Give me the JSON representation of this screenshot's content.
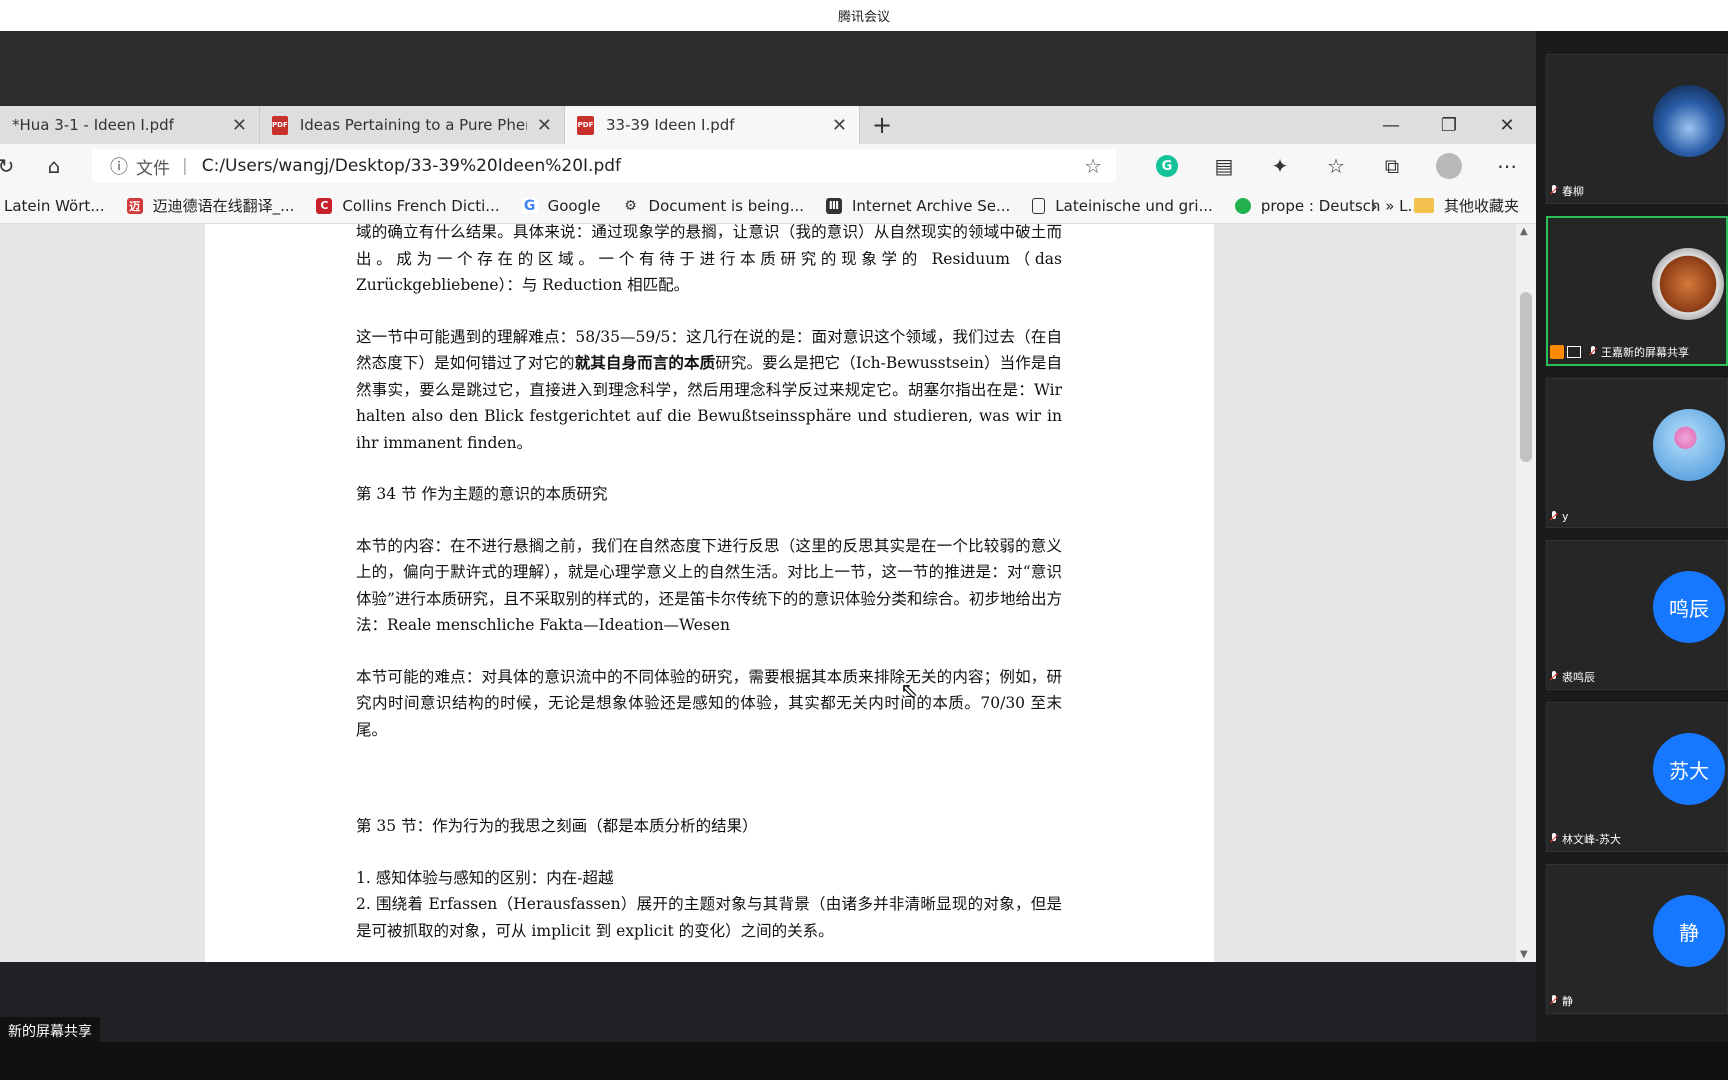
{
  "app": {
    "title": "腾讯会议"
  },
  "browser": {
    "tabs": [
      {
        "label": "*Hua 3-1 - Ideen I.pdf",
        "close": "✕"
      },
      {
        "label": "Ideas Pertaining to a Pure Pheno",
        "close": "✕"
      },
      {
        "label": "33-39 Ideen I.pdf",
        "close": "✕"
      }
    ],
    "new_tab": "+",
    "window": {
      "minimize": "—",
      "restore": "❐",
      "close": "✕"
    },
    "address": {
      "file_label": "文件",
      "url": "C:/Users/wangj/Desktop/33-39%20Ideen%20I.pdf"
    },
    "icons": [
      "refresh-icon",
      "home-icon",
      "info-icon",
      "favorite-add-icon",
      "grammarly-icon",
      "reading-icon",
      "extensions-icon",
      "favorites-icon",
      "collections-icon",
      "profile-icon",
      "more-icon"
    ],
    "bookmarks": [
      {
        "label": "Latein Wört..."
      },
      {
        "label": "迈迪德语在线翻译_..."
      },
      {
        "label": "Collins French Dicti..."
      },
      {
        "label": "Google"
      },
      {
        "label": "Document is being..."
      },
      {
        "label": "Internet Archive Se..."
      },
      {
        "label": "Lateinische und gri..."
      },
      {
        "label": "prope : Deutsch » L..."
      }
    ],
    "other_bookmarks": "其他收藏夹"
  },
  "document": {
    "p1": "域的确立有什么结果。具体来说：通过现象学的悬搁，让意识（我的意识）从自然现实的领域中破土而出。成为一个存在的区域。一个有待于进行本质研究的现象学的 Residuum（das Zurückgebliebene）：与 Reduction 相匹配。",
    "p2_a": "这一节中可能遇到的理解难点：58/35—59/5：这几行在说的是：面对意识这个领域，我们过去（在自然态度下）是如何错过了对它的",
    "p2_bold": "就其自身而言的本质",
    "p2_b": "研究。要么是把它（Ich-Bewusstsein）当作是自然事实，要么是跳过它，直接进入到理念科学，然后用理念科学反过来规定它。胡塞尔指出在是：Wir halten also den Blick festgerichtet auf die Bewußtseinssphäre und studieren, was wir in ihr immanent finden。",
    "h34": "第 34 节  作为主题的意识的本质研究",
    "p3": "本节的内容：在不进行悬搁之前，我们在自然态度下进行反思（这里的反思其实是在一个比较弱的意义上的，偏向于默许式的理解），就是心理学意义上的自然生活。对比上一节，这一节的推进是：对“意识体验”进行本质研究，且不采取别的样式的，还是笛卡尔传统下的的意识体验分类和综合。初步地给出方法：Reale menschliche Fakta—Ideation—Wesen",
    "p4": "本节可能的难点：对具体的意识流中的不同体验的研究，需要根据其本质来排除无关的内容；例如，研究内时间意识结构的时候，无论是想象体验还是感知的体验，其实都无关内时间的本质。70/30 至末尾。",
    "h35": "第 35 节：作为行为的我思之刻画（都是本质分析的结果）",
    "item1": "1. 感知体验与感知的区别：内在-超越",
    "item2": "2. 围绕着 Erfassen（Herausfassen）展开的主题对象与其背景（由诸多并非清晰显现的对象，但是是可被抓取的对象，可从 implicit 到 explicit 的变化）之间的关系。"
  },
  "meeting": {
    "share_label": "新的屏幕共享",
    "participants": [
      {
        "name": "春柳",
        "avatar": ""
      },
      {
        "name": "王嘉新的屏幕共享",
        "avatar": ""
      },
      {
        "name": "y",
        "avatar": ""
      },
      {
        "name": "裘鸣辰",
        "avatar": "鸣辰"
      },
      {
        "name": "林文峰-苏大",
        "avatar": "苏大"
      },
      {
        "name": "静",
        "avatar": "静"
      }
    ]
  }
}
